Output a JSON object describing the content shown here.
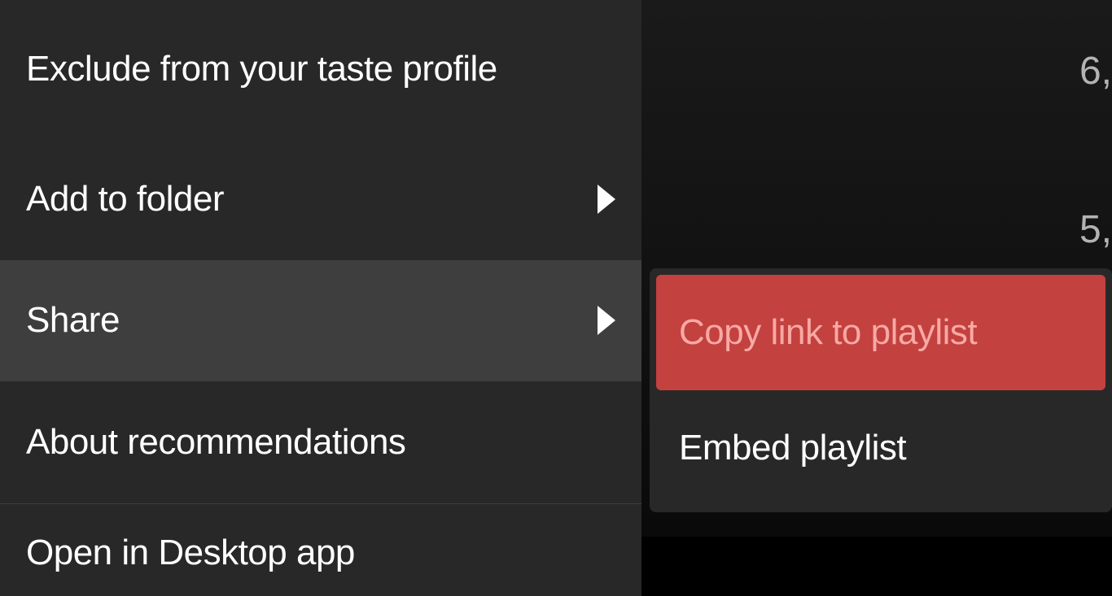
{
  "contextMenu": {
    "items": [
      {
        "label": "Exclude from your taste profile",
        "hasSubmenu": false
      },
      {
        "label": "Add to folder",
        "hasSubmenu": true
      },
      {
        "label": "Share",
        "hasSubmenu": true
      },
      {
        "label": "About recommendations",
        "hasSubmenu": false
      },
      {
        "label": "Open in Desktop app",
        "hasSubmenu": false
      }
    ]
  },
  "submenu": {
    "items": [
      {
        "label": "Copy link to playlist",
        "highlighted": true
      },
      {
        "label": "Embed playlist",
        "highlighted": false
      }
    ]
  },
  "background": {
    "numbers": [
      "6,",
      "5,"
    ]
  },
  "colors": {
    "menuBg": "#282828",
    "menuHover": "#3e3e3e",
    "highlightBg": "#c3413f",
    "highlightText": "#f8a9a4",
    "text": "#ffffff",
    "mutedText": "#b3b3b3"
  }
}
